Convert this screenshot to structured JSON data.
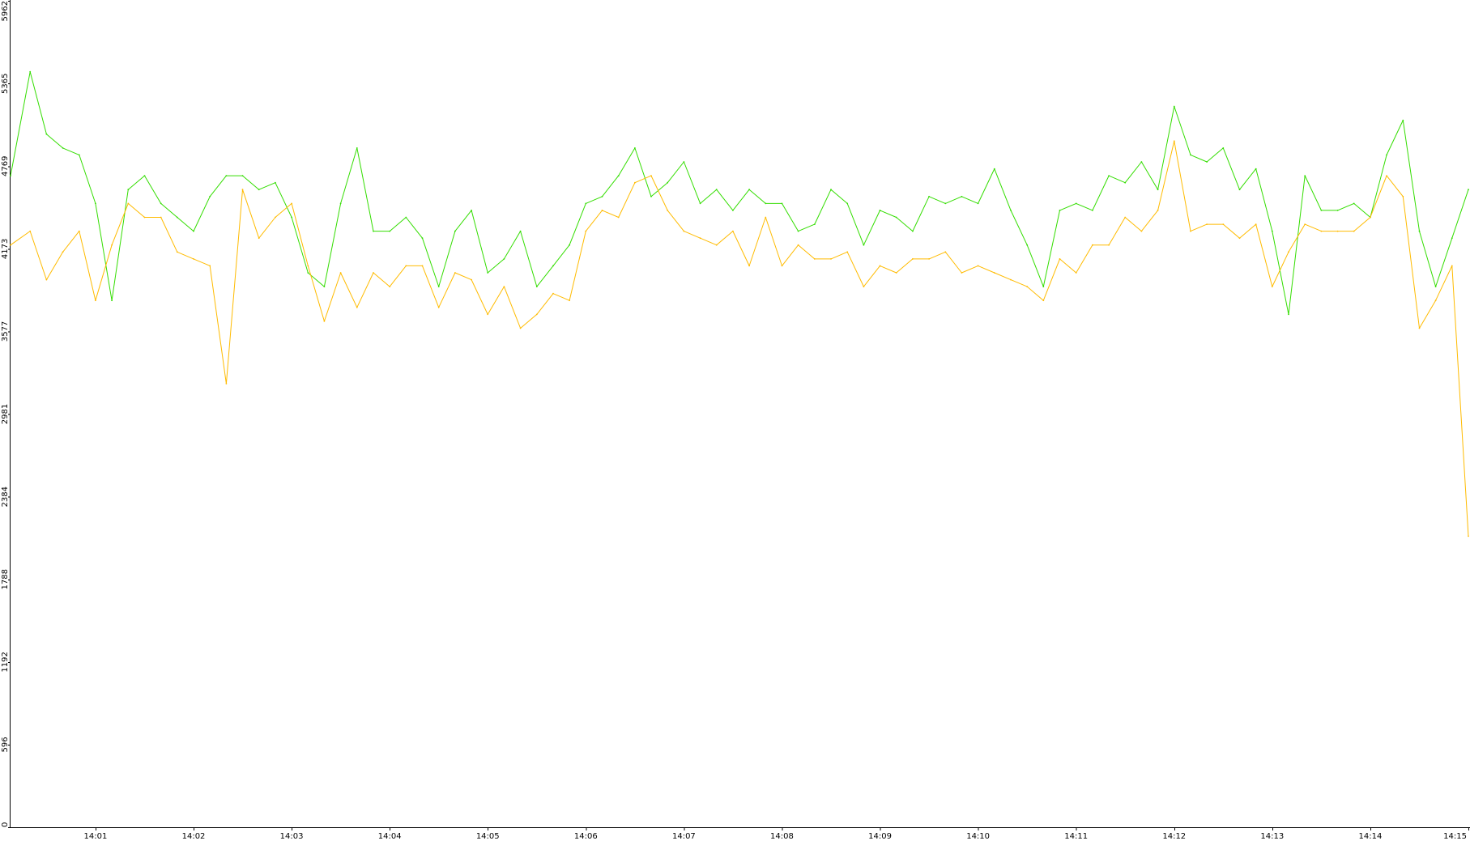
{
  "chart_data": {
    "type": "line",
    "title": "",
    "xlabel": "",
    "ylabel": "",
    "ylim": [
      0,
      5962
    ],
    "y_ticks": [
      "0",
      "596",
      "1192",
      "1788",
      "2384",
      "2981",
      "3577",
      "4173",
      "4769",
      "5365",
      "5962"
    ],
    "x_ticks": [
      "14:01",
      "14:02",
      "14:03",
      "14:04",
      "14:05",
      "14:06",
      "14:07",
      "14:08",
      "14:09",
      "14:10",
      "14:11",
      "14:12",
      "14:13",
      "14:14",
      "14:15"
    ],
    "x_range": [
      "14:00:08",
      "14:15:00"
    ],
    "grid": false,
    "legend": "none",
    "series": [
      {
        "color": "#33dd00",
        "x": [
          "14:00:08",
          "14:00:20",
          "14:00:30",
          "14:00:40",
          "14:00:50",
          "14:01:00",
          "14:01:10",
          "14:01:20",
          "14:01:30",
          "14:01:40",
          "14:01:50",
          "14:02:00",
          "14:02:10",
          "14:02:20",
          "14:02:30",
          "14:02:40",
          "14:02:50",
          "14:03:00",
          "14:03:10",
          "14:03:20",
          "14:03:30",
          "14:03:40",
          "14:03:50",
          "14:04:00",
          "14:04:10",
          "14:04:20",
          "14:04:30",
          "14:04:40",
          "14:04:50",
          "14:05:00",
          "14:05:10",
          "14:05:20",
          "14:05:30",
          "14:05:40",
          "14:05:50",
          "14:06:00",
          "14:06:10",
          "14:06:20",
          "14:06:30",
          "14:06:40",
          "14:06:50",
          "14:07:00",
          "14:07:10",
          "14:07:20",
          "14:07:30",
          "14:07:40",
          "14:07:50",
          "14:08:00",
          "14:08:10",
          "14:08:20",
          "14:08:30",
          "14:08:40",
          "14:08:50",
          "14:09:00",
          "14:09:10",
          "14:09:20",
          "14:09:30",
          "14:09:40",
          "14:09:50",
          "14:10:00",
          "14:10:10",
          "14:10:20",
          "14:10:30",
          "14:10:40",
          "14:10:50",
          "14:11:00",
          "14:11:10",
          "14:11:20",
          "14:11:30",
          "14:11:40",
          "14:11:50",
          "14:12:00",
          "14:12:10",
          "14:12:20",
          "14:12:30",
          "14:12:40",
          "14:12:50",
          "14:13:00",
          "14:13:10",
          "14:13:20",
          "14:13:30",
          "14:13:40",
          "14:13:50",
          "14:14:00",
          "14:14:10",
          "14:14:20",
          "14:14:30",
          "14:14:40",
          "14:14:50",
          "14:15:00"
        ],
        "values": [
          4700,
          5450,
          5000,
          4900,
          4850,
          4500,
          3800,
          4600,
          4700,
          4500,
          4400,
          4300,
          4550,
          4700,
          4700,
          4600,
          4650,
          4400,
          4000,
          3900,
          4500,
          4900,
          4300,
          4300,
          4400,
          4250,
          3900,
          4300,
          4450,
          4000,
          4100,
          4300,
          3900,
          4050,
          4200,
          4500,
          4550,
          4700,
          4900,
          4550,
          4650,
          4800,
          4500,
          4600,
          4450,
          4600,
          4500,
          4500,
          4300,
          4350,
          4600,
          4500,
          4200,
          4450,
          4400,
          4300,
          4550,
          4500,
          4550,
          4500,
          4750,
          4450,
          4200,
          3900,
          4450,
          4500,
          4450,
          4700,
          4650,
          4800,
          4600,
          5200,
          4850,
          4800,
          4900,
          4600,
          4750,
          4300,
          3700,
          4700,
          4450,
          4450,
          4500,
          4400,
          4850,
          5100,
          4300,
          3900,
          4250,
          4600
        ]
      },
      {
        "color": "#ffbb00",
        "x": [
          "14:00:08",
          "14:00:20",
          "14:00:30",
          "14:00:40",
          "14:00:50",
          "14:01:00",
          "14:01:10",
          "14:01:20",
          "14:01:30",
          "14:01:40",
          "14:01:50",
          "14:02:00",
          "14:02:10",
          "14:02:20",
          "14:02:30",
          "14:02:40",
          "14:02:50",
          "14:03:00",
          "14:03:10",
          "14:03:20",
          "14:03:30",
          "14:03:40",
          "14:03:50",
          "14:04:00",
          "14:04:10",
          "14:04:20",
          "14:04:30",
          "14:04:40",
          "14:04:50",
          "14:05:00",
          "14:05:10",
          "14:05:20",
          "14:05:30",
          "14:05:40",
          "14:05:50",
          "14:06:00",
          "14:06:10",
          "14:06:20",
          "14:06:30",
          "14:06:40",
          "14:06:50",
          "14:07:00",
          "14:07:10",
          "14:07:20",
          "14:07:30",
          "14:07:40",
          "14:07:50",
          "14:08:00",
          "14:08:10",
          "14:08:20",
          "14:08:30",
          "14:08:40",
          "14:08:50",
          "14:09:00",
          "14:09:10",
          "14:09:20",
          "14:09:30",
          "14:09:40",
          "14:09:50",
          "14:10:00",
          "14:10:10",
          "14:10:20",
          "14:10:30",
          "14:10:40",
          "14:10:50",
          "14:11:00",
          "14:11:10",
          "14:11:20",
          "14:11:30",
          "14:11:40",
          "14:11:50",
          "14:12:00",
          "14:12:10",
          "14:12:20",
          "14:12:30",
          "14:12:40",
          "14:12:50",
          "14:13:00",
          "14:13:10",
          "14:13:20",
          "14:13:30",
          "14:13:40",
          "14:13:50",
          "14:14:00",
          "14:14:10",
          "14:14:20",
          "14:14:30",
          "14:14:40",
          "14:14:50",
          "14:15:00"
        ],
        "values": [
          4200,
          4300,
          3950,
          4150,
          4300,
          3800,
          4200,
          4500,
          4400,
          4400,
          4150,
          4100,
          4050,
          3200,
          4600,
          4250,
          4400,
          4500,
          4050,
          3650,
          4000,
          3750,
          4000,
          3900,
          4050,
          4050,
          3750,
          4000,
          3950,
          3700,
          3900,
          3600,
          3700,
          3850,
          3800,
          4300,
          4450,
          4400,
          4650,
          4700,
          4450,
          4300,
          4250,
          4200,
          4300,
          4050,
          4400,
          4050,
          4200,
          4100,
          4100,
          4150,
          3900,
          4050,
          4000,
          4100,
          4100,
          4150,
          4000,
          4050,
          4000,
          3950,
          3900,
          3800,
          4100,
          4000,
          4200,
          4200,
          4400,
          4300,
          4450,
          4950,
          4300,
          4350,
          4350,
          4250,
          4350,
          3900,
          4150,
          4350,
          4300,
          4300,
          4300,
          4400,
          4700,
          4550,
          3600,
          3800,
          4050,
          2100
        ]
      }
    ]
  }
}
